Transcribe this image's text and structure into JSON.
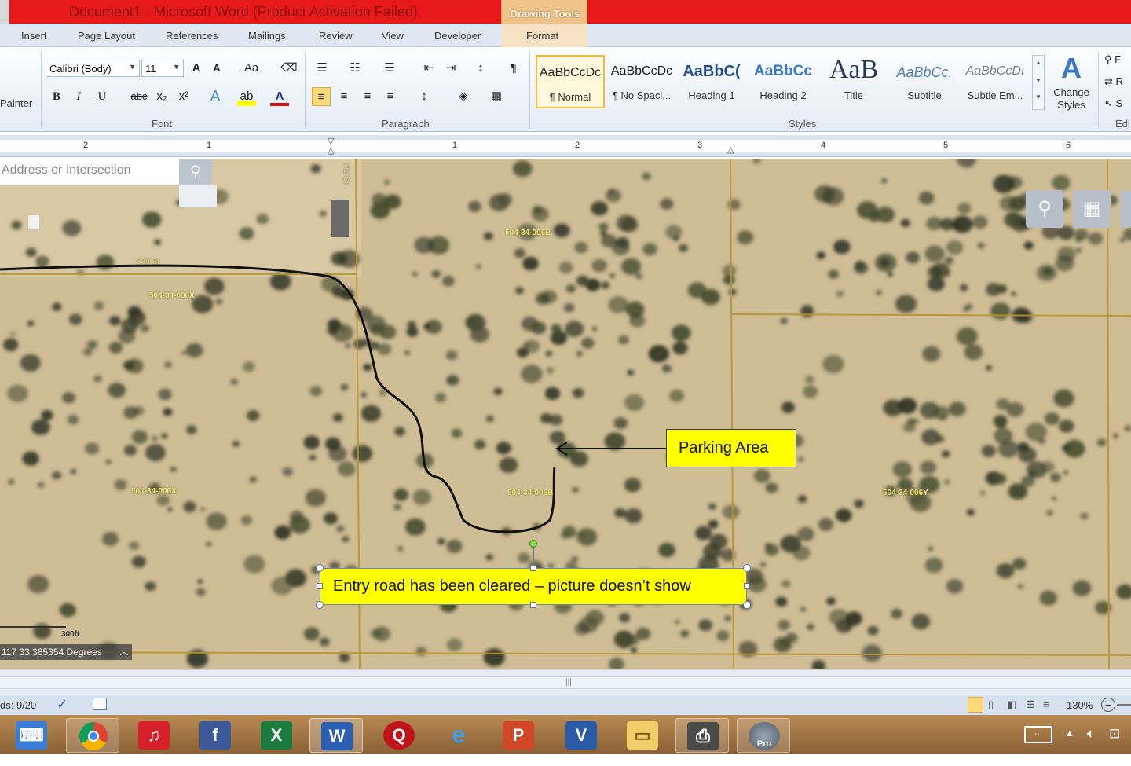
{
  "window": {
    "title": "Document1  -  Microsoft Word (Product Activation Failed)",
    "contextual_tab_group": "Drawing Tools"
  },
  "tabs": [
    "Insert",
    "Page Layout",
    "References",
    "Mailings",
    "Review",
    "View",
    "Developer",
    "Format"
  ],
  "ribbon": {
    "clipboard": {
      "painter_label": "Painter"
    },
    "font": {
      "group_label": "Font",
      "font_name": "Calibri (Body)",
      "font_size": "11",
      "buttons": [
        "A",
        "A",
        "Aa",
        "B",
        "I",
        "U",
        "abc",
        "x₂",
        "x²",
        "A",
        "A"
      ]
    },
    "paragraph": {
      "group_label": "Paragraph"
    },
    "styles": {
      "group_label": "Styles",
      "items": [
        {
          "sample": "AaBbCcDc",
          "name": "¶ Normal"
        },
        {
          "sample": "AaBbCcDc",
          "name": "¶ No Spaci..."
        },
        {
          "sample": "AaBbC(",
          "name": "Heading 1"
        },
        {
          "sample": "AaBbCc",
          "name": "Heading 2"
        },
        {
          "sample": "AaB",
          "name": "Title"
        },
        {
          "sample": "AaBbCc.",
          "name": "Subtitle"
        },
        {
          "sample": "AaBbCcDı",
          "name": "Subtle Em..."
        }
      ],
      "change_styles": "Change Styles",
      "selected_index": 0
    },
    "editing": {
      "group_label": "Edi",
      "find": "F",
      "replace": "R",
      "select": "S"
    }
  },
  "ruler": {
    "numbers": [
      "2",
      "1",
      "1",
      "1",
      "2",
      "3",
      "4",
      "5",
      "6"
    ]
  },
  "map": {
    "search_placeholder": "Address or Intersection",
    "road_label": "330 St",
    "side_road_label": "Hz St",
    "parcels": [
      "504-34-006B",
      "504-34-006X",
      "504-34-006X",
      "504-34-006B",
      "504-34-006Y"
    ],
    "scale_label": "300ft",
    "coordinate_readout": "117 33.385354 Degrees"
  },
  "callouts": {
    "parking": "Parking Area",
    "entry_road": "Entry road has been cleared – picture doesn’t show"
  },
  "statusbar": {
    "words": "ds: 9/20",
    "zoom": "130%"
  },
  "taskbar": {
    "apps": [
      "keyboard-app-icon",
      "chrome-icon",
      "music-icon",
      "facebook-icon",
      "excel-icon",
      "word-icon",
      "quicken-icon",
      "internet-explorer-icon",
      "powerpoint-icon",
      "visio-icon",
      "file-explorer-icon",
      "scanner-icon",
      "google-earth-pro-icon"
    ]
  },
  "colors": {
    "title_bar": "#e8191a",
    "callout_fill": "#ffff00",
    "drawing_tools": "#f0c38a"
  }
}
